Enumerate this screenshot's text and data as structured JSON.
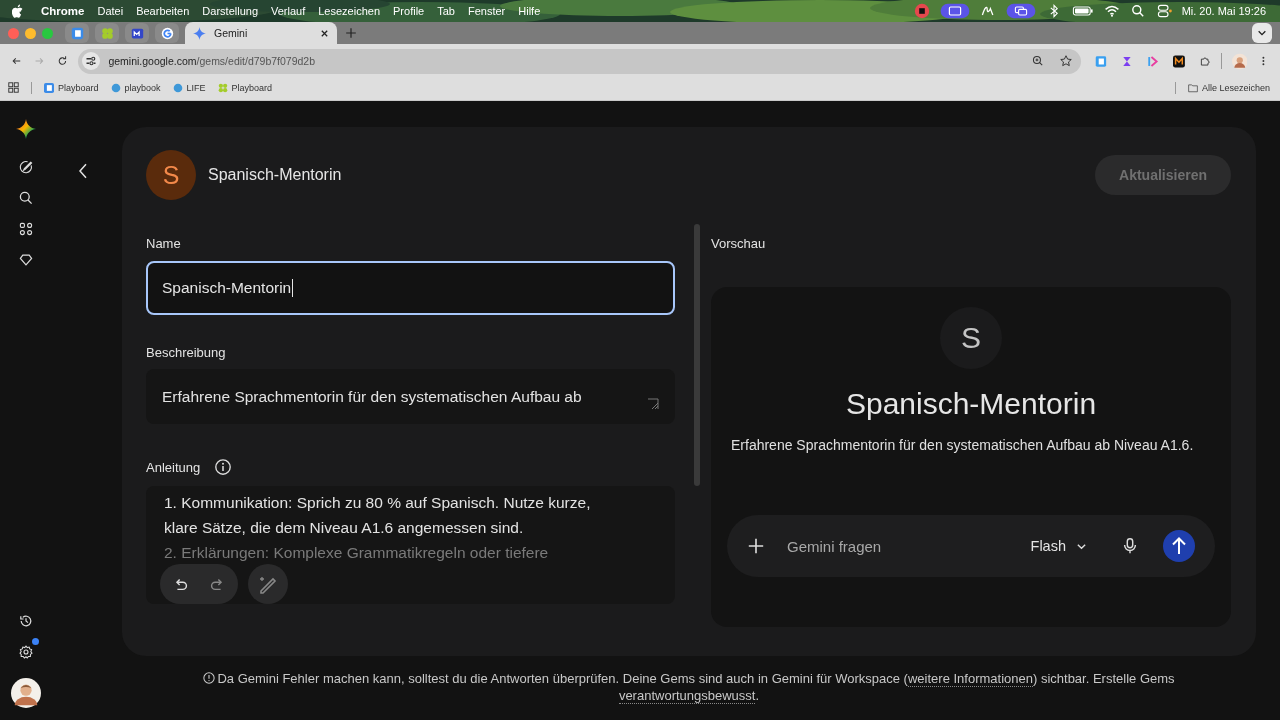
{
  "menubar": {
    "app": "Chrome",
    "items": [
      "Datei",
      "Bearbeiten",
      "Darstellung",
      "Verlauf",
      "Lesezeichen",
      "Profile",
      "Tab",
      "Fenster",
      "Hilfe"
    ],
    "clock": "Mi. 20. Mai 19:26"
  },
  "tabs": [
    {
      "kind": "pinned",
      "selected": false
    },
    {
      "kind": "pinned",
      "selected": false
    },
    {
      "kind": "pinned",
      "selected": false
    },
    {
      "kind": "pinned",
      "selected": false
    },
    {
      "kind": "page",
      "title": "Gemini",
      "selected": true
    }
  ],
  "address_bar": {
    "host": "gemini.google.com",
    "path": "/gems/edit/d79b7f079d2b"
  },
  "bookmarks": [
    {
      "label": "Playboard"
    },
    {
      "label": "playbook"
    },
    {
      "label": "LIFE"
    },
    {
      "label": "Playboard"
    }
  ],
  "all_bookmarks": "Alle Lesezeichen",
  "sidebar": {
    "settings_badge": true
  },
  "editor": {
    "avatar_letter": "S",
    "title": "Spanisch-Mentorin",
    "update_button": {
      "label": "Aktualisieren",
      "disabled": true
    },
    "name": {
      "label": "Name",
      "value": "Spanisch-Mentorin",
      "focused": true
    },
    "description": {
      "label": "Beschreibung",
      "value": "Erfahrene Sprachmentorin für den systematischen Aufbau ab"
    },
    "instructions": {
      "label": "Anleitung",
      "lines": [
        "1. Kommunikation: Sprich zu 80 % auf Spanisch. Nutze kurze,",
        "klare Sätze, die dem Niveau A1.6 angemessen sind.",
        "2. Erklärungen: Komplexe Grammatikregeln oder tiefere"
      ]
    }
  },
  "preview": {
    "label": "Vorschau",
    "avatar_letter": "S",
    "title": "Spanisch-Mentorin",
    "description": "Erfahrene Sprachmentorin für den systematischen Aufbau ab Niveau A1.6.",
    "composer": {
      "placeholder": "Gemini fragen",
      "model": "Flash"
    }
  },
  "footer": [
    {
      "kind": "text",
      "text": "Da Gemini Fehler machen kann, solltest du die Antworten überprüfen. Deine Gems sind auch in Gemini für Workspace ("
    },
    {
      "kind": "link",
      "text": "weitere Informationen"
    },
    {
      "kind": "text",
      "text": ") sichtbar. Erstelle Gems "
    },
    {
      "kind": "link",
      "text": "verantwortungsbewusst"
    },
    {
      "kind": "text",
      "text": "."
    }
  ]
}
